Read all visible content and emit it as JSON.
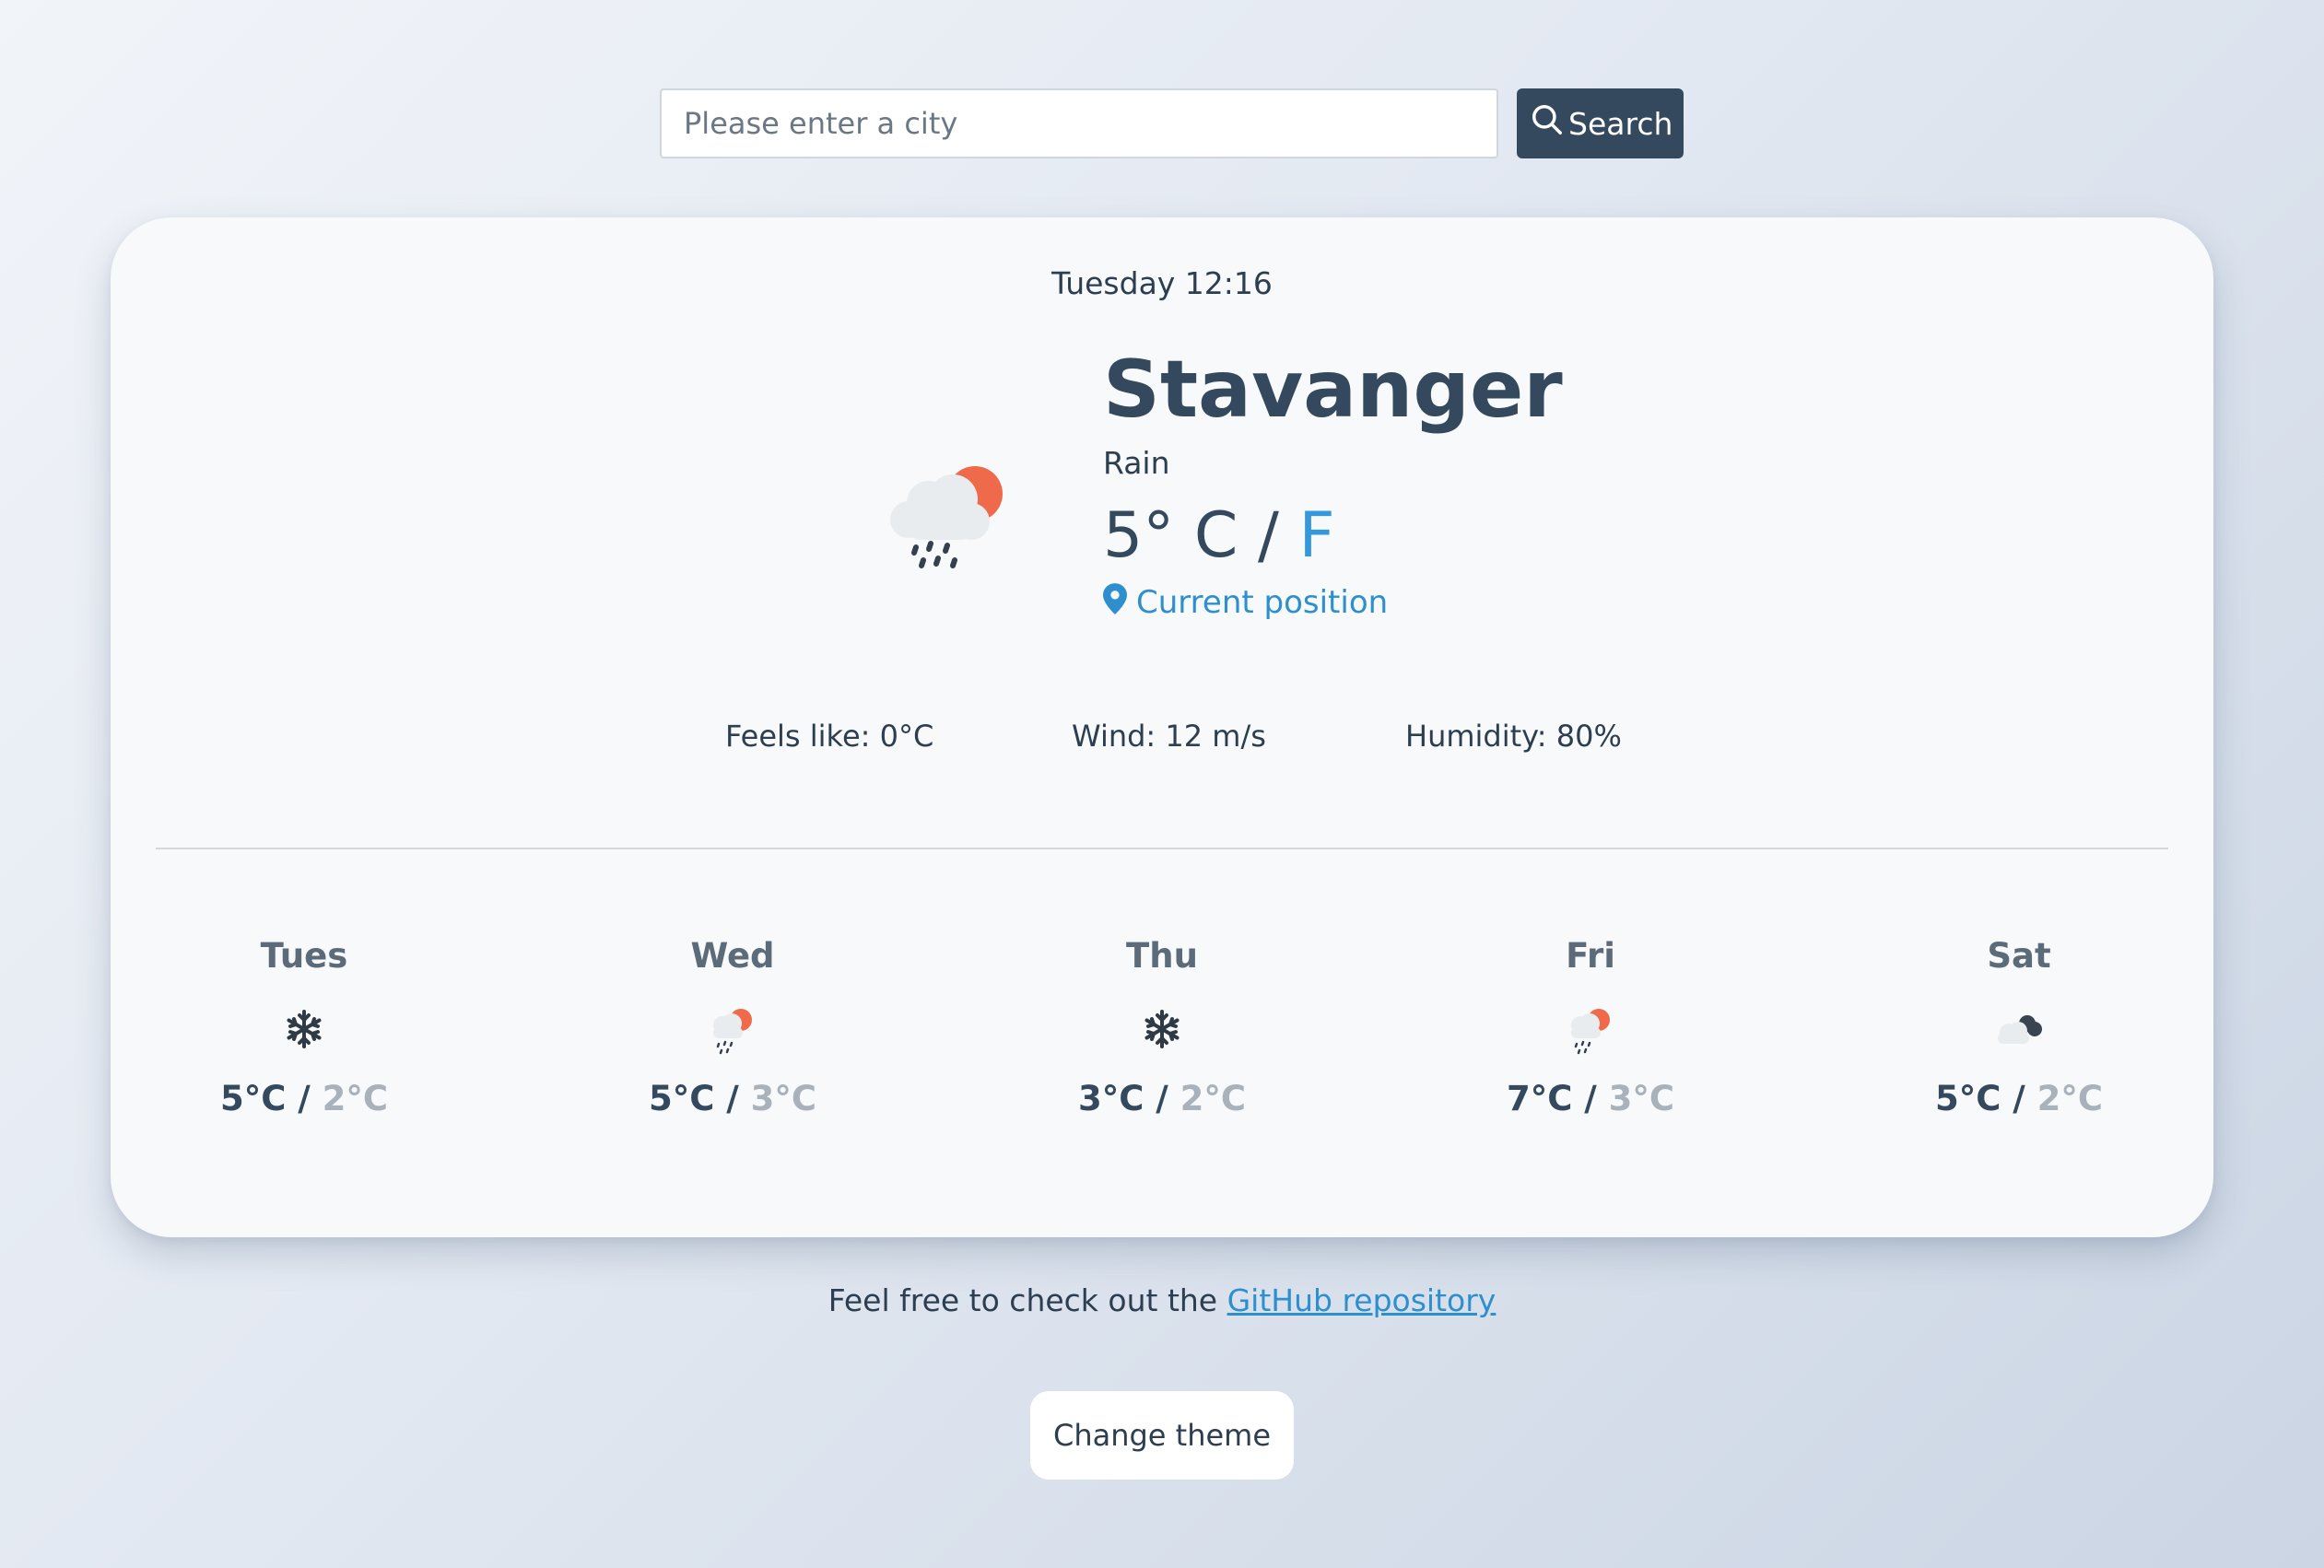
{
  "search": {
    "placeholder": "Please enter a city",
    "button_label": "Search",
    "button_color": "#34495e"
  },
  "current": {
    "datetime": "Tuesday 12:16",
    "city": "Stavanger",
    "condition": "Rain",
    "icon": "cloud-rain-sun-icon",
    "temp_value": "5°",
    "unit_c": "C",
    "unit_sep": " / ",
    "unit_f": "F",
    "position_label": "Current position",
    "feels_like": "Feels like: 0°C",
    "wind": "Wind: 12 m/s",
    "humidity": "Humidity: 80%"
  },
  "forecast": [
    {
      "day": "Tues",
      "icon": "snowflake-icon",
      "high": "5°C",
      "low": "2°C"
    },
    {
      "day": "Wed",
      "icon": "cloud-rain-sun-icon",
      "high": "5°C",
      "low": "3°C"
    },
    {
      "day": "Thu",
      "icon": "snowflake-icon",
      "high": "3°C",
      "low": "2°C"
    },
    {
      "day": "Fri",
      "icon": "cloud-rain-sun-icon",
      "high": "7°C",
      "low": "3°C"
    },
    {
      "day": "Sat",
      "icon": "cloudy-icon",
      "high": "5°C",
      "low": "2°C"
    }
  ],
  "footer": {
    "text": "Feel free to check out the ",
    "link_label": "GitHub repository",
    "theme_button": "Change theme"
  },
  "colors": {
    "accent": "#3498db",
    "sun": "#ee6a4a",
    "text": "#2c3e50",
    "muted": "#a9b2bb"
  }
}
